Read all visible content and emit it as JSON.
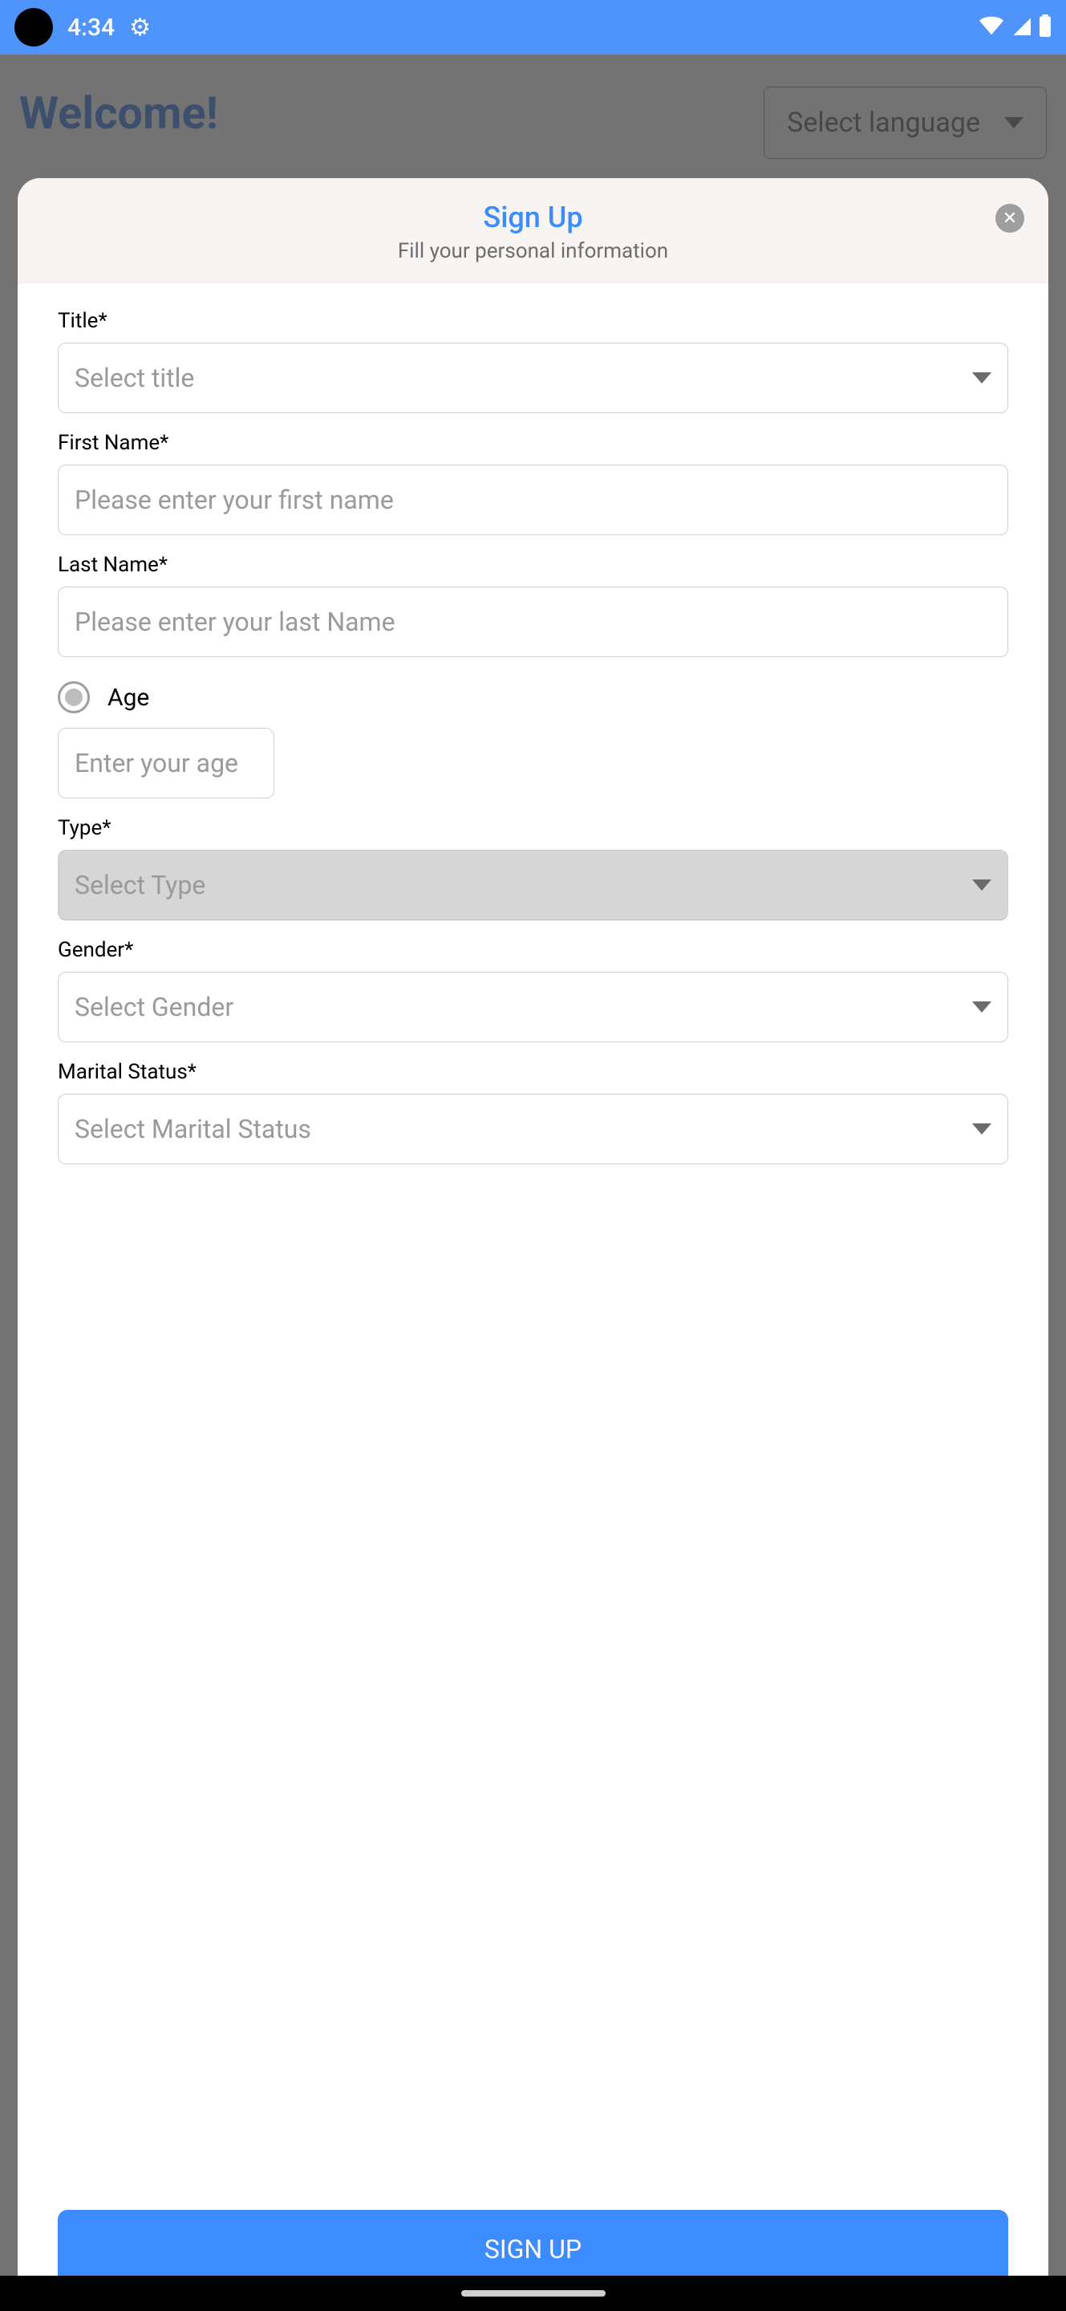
{
  "status": {
    "clock": "4:34"
  },
  "backdrop": {
    "welcome": "Welcome!",
    "language_placeholder": "Select language"
  },
  "modal": {
    "title": "Sign Up",
    "subtitle": "Fill your personal information",
    "title_label": "Title*",
    "title_placeholder": "Select title",
    "first_name_label": "First Name*",
    "first_name_placeholder": "Please enter your first name",
    "last_name_label": "Last Name*",
    "last_name_placeholder": "Please enter your last Name",
    "age_label": "Age",
    "age_placeholder": "Enter your age",
    "type_label": "Type*",
    "type_placeholder": "Select Type",
    "gender_label": "Gender*",
    "gender_placeholder": "Select Gender",
    "marital_label": "Marital Status*",
    "marital_placeholder": "Select Marital Status",
    "signup_button": "SIGN UP"
  }
}
